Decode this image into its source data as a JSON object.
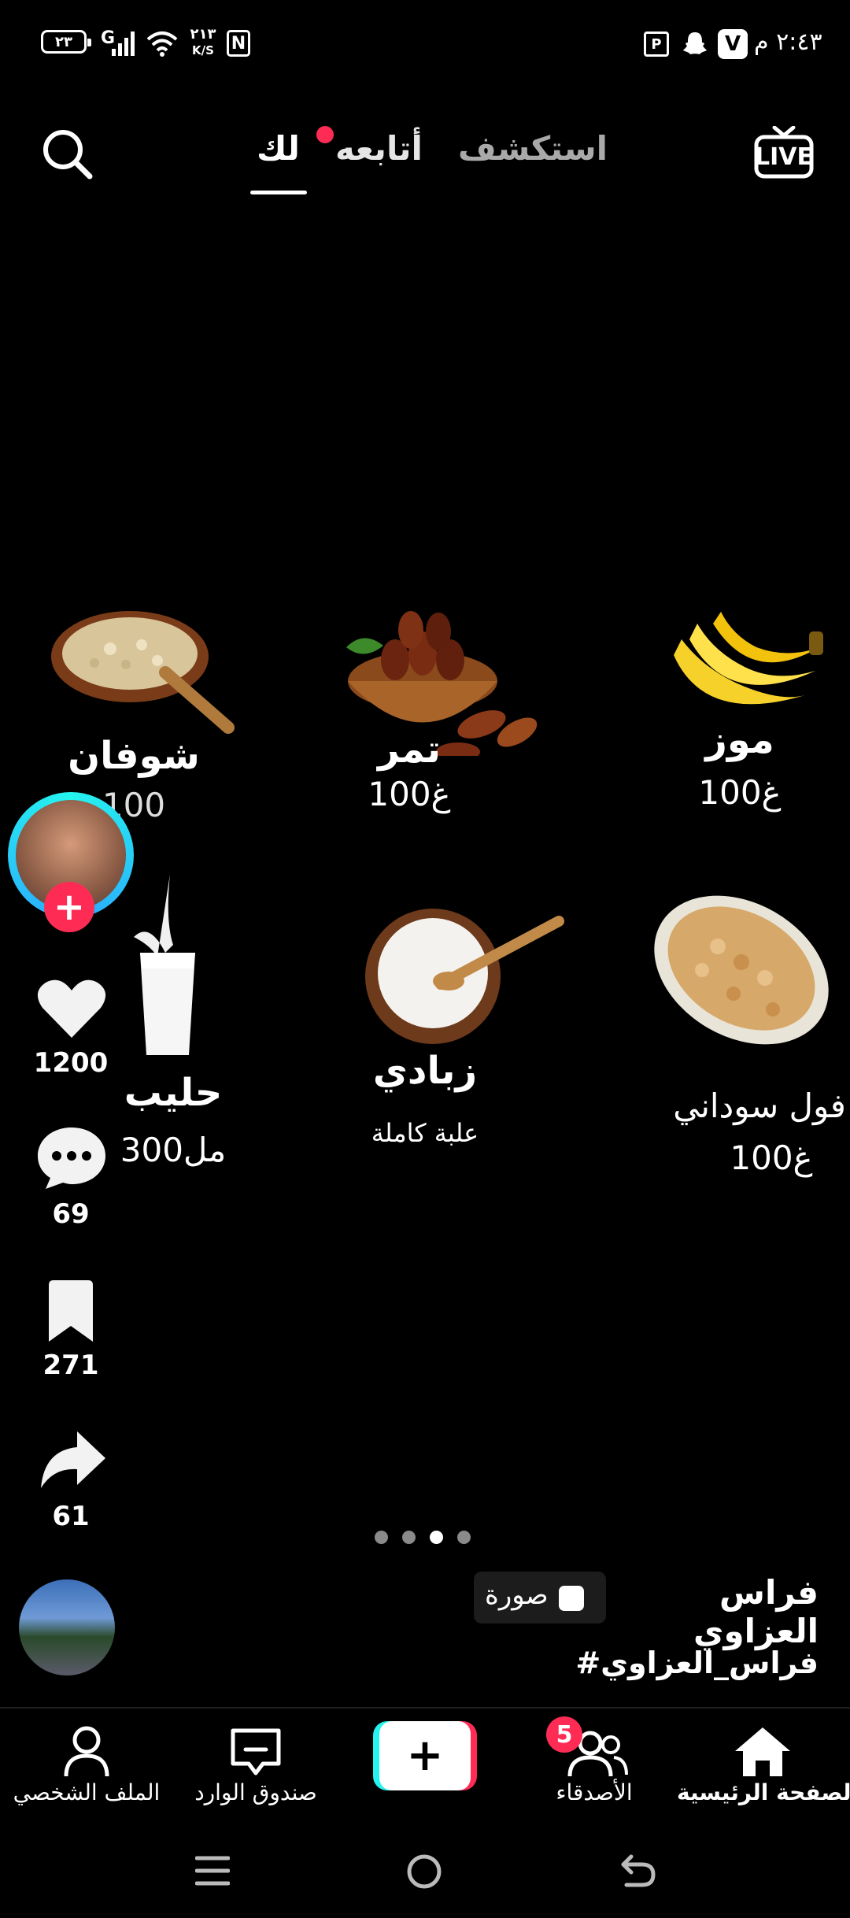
{
  "status_bar": {
    "time": "٢:٤٣ م",
    "battery": "٢٣",
    "net_speed": "٢١٣",
    "net_unit": "K/S",
    "signal_label": "G"
  },
  "top_nav": {
    "tabs": [
      {
        "label": "استكشف",
        "active": false
      },
      {
        "label": "أتابعه",
        "active": false,
        "dot": true
      },
      {
        "label": "لك",
        "active": true
      }
    ],
    "live_label": "LIVE"
  },
  "foods": [
    {
      "name": "موز",
      "qty": "100غ",
      "icon": "banana-image"
    },
    {
      "name": "تمر",
      "qty": "100غ",
      "icon": "dates-image"
    },
    {
      "name": "شوفان",
      "qty": "100",
      "icon": "oats-image"
    },
    {
      "name": "فول سوداني",
      "qty": "100غ",
      "icon": "peanuts-image"
    },
    {
      "name": "زبادي",
      "qty": "علبة كاملة",
      "icon": "yogurt-image"
    },
    {
      "name": "حليب",
      "qty": "300مل",
      "icon": "milk-image"
    }
  ],
  "rail": {
    "likes": "1200",
    "comments": "69",
    "saves": "271",
    "shares": "61"
  },
  "carousel": {
    "count": 4,
    "active_index": 2
  },
  "post": {
    "author": "فراس العزاوي",
    "type_badge": "صورة",
    "hashtag": "#فراس_العزاوي"
  },
  "bottom_nav": {
    "items": [
      {
        "label": "الصفحة الرئيسية",
        "icon": "home-icon"
      },
      {
        "label": "الأصدقاء",
        "icon": "friends-icon",
        "badge": "5"
      },
      {
        "label": "",
        "icon": "plus-icon"
      },
      {
        "label": "صندوق الوارد",
        "icon": "inbox-icon"
      },
      {
        "label": "الملف الشخصي",
        "icon": "profile-icon"
      }
    ]
  },
  "colors": {
    "accent": "#fe2c55",
    "cyan": "#25f4ee",
    "muted": "#9a9a9a"
  }
}
